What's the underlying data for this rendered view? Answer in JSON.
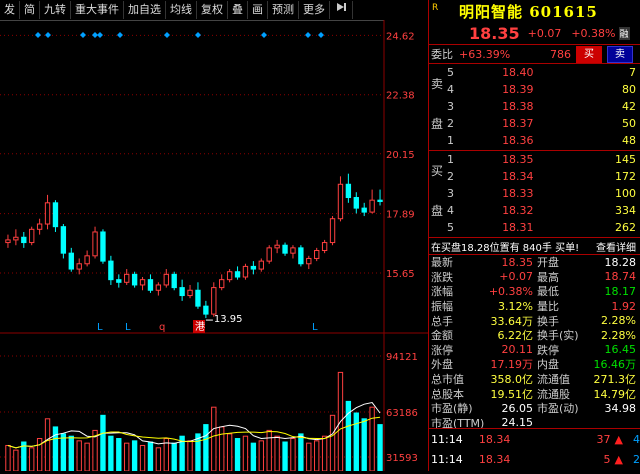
{
  "toolbar": {
    "items": [
      "发",
      "简",
      "九转",
      "重大事件",
      "加自选",
      "均线",
      "复权",
      "叠",
      "画",
      "预测",
      "更多"
    ],
    "pin_icon": "pin-icon"
  },
  "chart": {
    "price_labels": [
      "24.62",
      "22.38",
      "20.15",
      "17.89",
      "15.65"
    ],
    "volume_labels": [
      "94121",
      "63186",
      "31593"
    ],
    "volume_unit": "X10",
    "low_label": "13.95",
    "markers": [
      "L",
      "L",
      "q",
      "港",
      "L"
    ],
    "colors": {
      "up": "#ff4040",
      "down": "#00ffff",
      "ma1": "#ffffff",
      "ma2": "#ffff00",
      "grid": "#8b0000",
      "diamond": "#00a0ff"
    }
  },
  "chart_data": {
    "type": "candlestick",
    "ylim": [
      13.5,
      25.2
    ],
    "candles": [
      [
        16.8,
        17.1,
        16.6,
        16.9
      ],
      [
        16.9,
        17.3,
        16.7,
        17.0
      ],
      [
        17.0,
        17.2,
        16.6,
        16.8
      ],
      [
        16.8,
        17.4,
        16.7,
        17.3
      ],
      [
        17.3,
        17.7,
        17.1,
        17.5
      ],
      [
        17.5,
        18.6,
        17.3,
        18.3
      ],
      [
        18.3,
        18.4,
        17.2,
        17.4
      ],
      [
        17.4,
        17.5,
        16.2,
        16.4
      ],
      [
        16.4,
        16.6,
        15.7,
        15.8
      ],
      [
        15.8,
        16.2,
        15.6,
        16.0
      ],
      [
        16.0,
        16.5,
        15.9,
        16.3
      ],
      [
        16.3,
        17.4,
        16.2,
        17.2
      ],
      [
        17.2,
        17.3,
        16.0,
        16.1
      ],
      [
        16.1,
        16.3,
        15.2,
        15.4
      ],
      [
        15.4,
        15.6,
        15.1,
        15.3
      ],
      [
        15.3,
        15.8,
        15.2,
        15.6
      ],
      [
        15.6,
        15.7,
        15.1,
        15.2
      ],
      [
        15.2,
        15.5,
        15.0,
        15.4
      ],
      [
        15.4,
        15.6,
        14.9,
        15.0
      ],
      [
        15.0,
        15.3,
        14.8,
        15.2
      ],
      [
        15.2,
        15.8,
        15.1,
        15.6
      ],
      [
        15.6,
        15.7,
        15.0,
        15.1
      ],
      [
        15.1,
        15.4,
        14.6,
        14.8
      ],
      [
        14.8,
        15.2,
        14.7,
        15.0
      ],
      [
        15.0,
        15.3,
        14.3,
        14.4
      ],
      [
        14.4,
        14.6,
        13.95,
        14.1
      ],
      [
        14.1,
        15.3,
        14.0,
        15.1
      ],
      [
        15.1,
        15.6,
        15.0,
        15.4
      ],
      [
        15.4,
        15.8,
        15.3,
        15.7
      ],
      [
        15.7,
        15.9,
        15.4,
        15.5
      ],
      [
        15.5,
        16.0,
        15.4,
        15.9
      ],
      [
        15.9,
        16.1,
        15.6,
        15.8
      ],
      [
        15.8,
        16.2,
        15.7,
        16.1
      ],
      [
        16.1,
        16.7,
        16.0,
        16.6
      ],
      [
        16.6,
        16.9,
        16.4,
        16.7
      ],
      [
        16.7,
        16.8,
        16.3,
        16.4
      ],
      [
        16.4,
        16.7,
        16.2,
        16.6
      ],
      [
        16.6,
        16.7,
        15.9,
        16.0
      ],
      [
        16.0,
        16.3,
        15.8,
        16.2
      ],
      [
        16.2,
        16.6,
        16.1,
        16.5
      ],
      [
        16.5,
        16.9,
        16.4,
        16.8
      ],
      [
        16.8,
        17.8,
        16.7,
        17.7
      ],
      [
        17.7,
        19.3,
        17.6,
        19.0
      ],
      [
        19.0,
        19.4,
        18.3,
        18.5
      ],
      [
        18.5,
        18.7,
        17.9,
        18.1
      ],
      [
        18.1,
        18.3,
        17.8,
        17.95
      ],
      [
        17.95,
        18.8,
        17.9,
        18.4
      ],
      [
        18.4,
        18.8,
        18.2,
        18.35
      ]
    ],
    "volumes": [
      22,
      18,
      25,
      20,
      28,
      45,
      38,
      32,
      30,
      26,
      24,
      35,
      48,
      30,
      28,
      24,
      26,
      22,
      25,
      20,
      28,
      24,
      30,
      26,
      32,
      40,
      55,
      38,
      32,
      28,
      30,
      24,
      26,
      35,
      30,
      25,
      28,
      32,
      24,
      26,
      30,
      48,
      85,
      60,
      50,
      45,
      55,
      40
    ]
  },
  "quote": {
    "badge": "R",
    "name": "明阳智能",
    "code": "601615",
    "price": "18.35",
    "change": "+0.07",
    "pct": "+0.38%",
    "rong": "融",
    "weibi_label": "委比",
    "weibi_pct": "+63.39%",
    "weibi_diff": "786",
    "buy_btn": "买",
    "sell_btn": "卖"
  },
  "sell_book": {
    "side": "卖盘",
    "rows": [
      {
        "lvl": "5",
        "price": "18.40",
        "vol": "7"
      },
      {
        "lvl": "4",
        "price": "18.39",
        "vol": "80"
      },
      {
        "lvl": "3",
        "price": "18.38",
        "vol": "42"
      },
      {
        "lvl": "2",
        "price": "18.37",
        "vol": "50"
      },
      {
        "lvl": "1",
        "price": "18.36",
        "vol": "48"
      }
    ]
  },
  "buy_book": {
    "side": "买盘",
    "rows": [
      {
        "lvl": "1",
        "price": "18.35",
        "vol": "145"
      },
      {
        "lvl": "2",
        "price": "18.34",
        "vol": "172"
      },
      {
        "lvl": "3",
        "price": "18.33",
        "vol": "100"
      },
      {
        "lvl": "4",
        "price": "18.32",
        "vol": "334"
      },
      {
        "lvl": "5",
        "price": "18.31",
        "vol": "262"
      }
    ]
  },
  "position": {
    "text": "在买盘18.28位置有 840手 买单!",
    "detail": "查看详细"
  },
  "stats": [
    {
      "l": "最新",
      "v": "18.35",
      "vc": "red",
      "l2": "开盘",
      "v2": "18.28",
      "v2c": "white"
    },
    {
      "l": "涨跌",
      "v": "+0.07",
      "vc": "red",
      "l2": "最高",
      "v2": "18.74",
      "v2c": "red"
    },
    {
      "l": "涨幅",
      "v": "+0.38%",
      "vc": "red",
      "l2": "最低",
      "v2": "18.17",
      "v2c": "green"
    },
    {
      "l": "振幅",
      "v": "3.12%",
      "vc": "yellow",
      "l2": "量比",
      "v2": "1.92",
      "v2c": "red"
    },
    {
      "l": "总手",
      "v": "33.64万",
      "vc": "yellow",
      "l2": "换手",
      "v2": "2.28%",
      "v2c": "yellow"
    },
    {
      "l": "金额",
      "v": "6.22亿",
      "vc": "yellow",
      "l2": "换手(实)",
      "v2": "2.28%",
      "v2c": "yellow"
    },
    {
      "l": "涨停",
      "v": "20.11",
      "vc": "red",
      "l2": "跌停",
      "v2": "16.45",
      "v2c": "green"
    },
    {
      "l": "外盘",
      "v": "17.19万",
      "vc": "red",
      "l2": "内盘",
      "v2": "16.46万",
      "v2c": "green"
    },
    {
      "l": "总市值",
      "v": "358.0亿",
      "vc": "yellow",
      "l2": "流通值",
      "v2": "271.3亿",
      "v2c": "yellow"
    },
    {
      "l": "总股本",
      "v": "19.51亿",
      "vc": "yellow",
      "l2": "流通股",
      "v2": "14.79亿",
      "v2c": "yellow"
    },
    {
      "l": "市盈(静)",
      "v": "26.05",
      "vc": "white",
      "l2": "市盈(动)",
      "v2": "34.98",
      "v2c": "white"
    },
    {
      "l": "市盈(TTM)",
      "v": "24.15",
      "vc": "white",
      "l2": "",
      "v2": "",
      "v2c": "white"
    }
  ],
  "ticks": [
    {
      "time": "11:14",
      "price": "18.34",
      "vol": "37",
      "num": "4"
    },
    {
      "time": "11:14",
      "price": "18.34",
      "vol": "5",
      "num": "2"
    }
  ]
}
